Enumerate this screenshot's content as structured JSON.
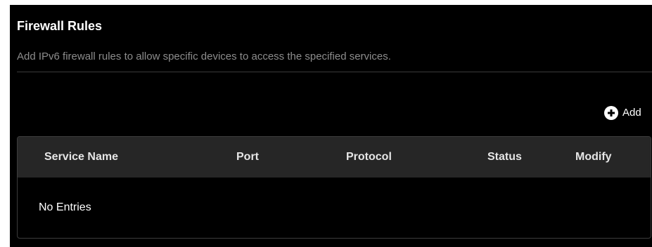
{
  "section": {
    "title": "Firewall Rules",
    "description": "Add IPv6 firewall rules to allow specific devices to access the specified services."
  },
  "actions": {
    "add_label": "Add",
    "add_icon": "plus-circle-icon"
  },
  "table": {
    "columns": [
      "Service Name",
      "Port",
      "Protocol",
      "Status",
      "Modify"
    ],
    "rows": [],
    "empty_text": "No Entries"
  },
  "colors": {
    "background": "#000000",
    "header_background": "#262626",
    "text": "#ffffff",
    "muted_text": "#8c8c8c"
  }
}
